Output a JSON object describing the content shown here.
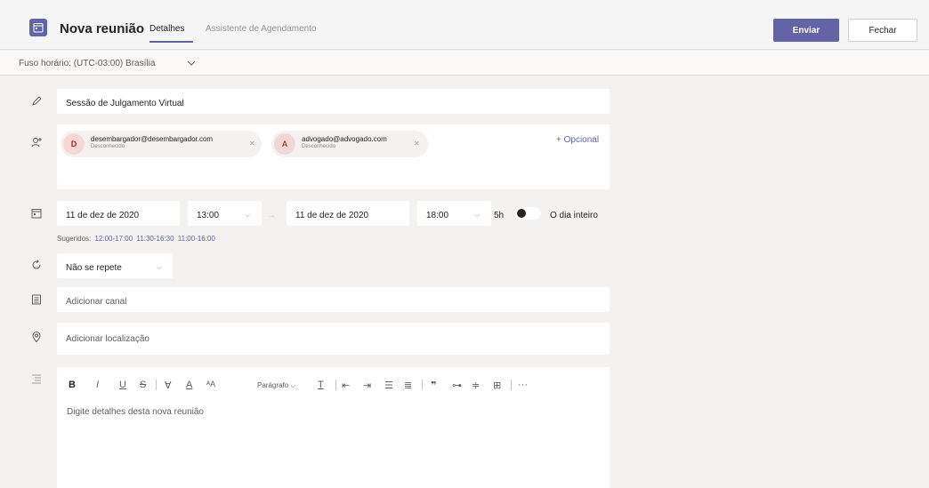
{
  "header": {
    "title": "Nova reunião",
    "tabs": [
      {
        "label": "Detalhes"
      },
      {
        "label": "Assistente de Agendamento"
      }
    ],
    "send_label": "Enviar",
    "close_label": "Fechar"
  },
  "timezone": {
    "label": "Fuso horário: (UTC-03:00) Brasília"
  },
  "form": {
    "title_value": "Sessão de Julgamento Virtual",
    "attendees": [
      {
        "initial": "D",
        "email": "desembargador@desembargador.com",
        "status": "Desconhecido",
        "color": "#f7d7d6",
        "text_color": "#a4262c"
      },
      {
        "initial": "A",
        "email": "advogado@advogado.com",
        "status": "Desconhecido",
        "color": "#f3d6d8",
        "text_color": "#8e562e"
      }
    ],
    "optional_label": "+ Opcional",
    "start_date": "11 de dez de 2020",
    "start_time": "13:00",
    "end_date": "11 de dez de 2020",
    "end_time": "18:00",
    "duration": "5h",
    "all_day_label": "O dia inteiro",
    "suggested_label": "Sugeridos:",
    "suggestions": [
      "12:00-17:00",
      "11:30-16:30",
      "11:00-16:00"
    ],
    "repeat_value": "Não se repete",
    "channel_placeholder": "Adicionar canal",
    "location_placeholder": "Adicionar localização",
    "paragraph_label": "Parágrafo",
    "details_placeholder": "Digite detalhes desta nova reunião"
  },
  "colors": {
    "accent": "#6264a7",
    "background": "#f3f2f1"
  }
}
